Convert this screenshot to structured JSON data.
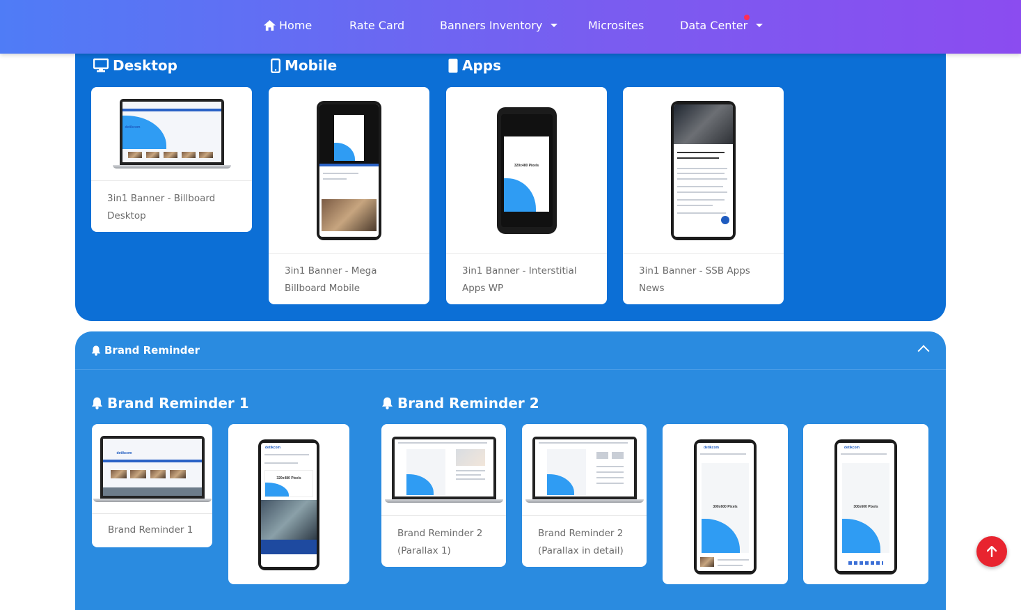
{
  "nav": {
    "home": "Home",
    "rate_card": "Rate Card",
    "banners_inventory": "Banners Inventory",
    "microsites": "Microsites",
    "data_center": "Data Center"
  },
  "sections": {
    "desktop": "Desktop",
    "mobile": "Mobile",
    "apps": "Apps"
  },
  "cards_top": [
    {
      "caption": "3in1 Banner - Billboard Desktop"
    },
    {
      "caption": "3in1 Banner - Mega Billboard Mobile"
    },
    {
      "caption": "3in1 Banner - Interstitial Apps WP"
    },
    {
      "caption": "3in1 Banner - SSB Apps News"
    }
  ],
  "brand_reminder": {
    "title": "Brand Reminder",
    "group1": "Brand Reminder 1",
    "group2": "Brand Reminder 2",
    "cards": [
      {
        "caption": "Brand Reminder 1"
      },
      {
        "caption": ""
      },
      {
        "caption": "Brand Reminder 2 (Parallax 1)"
      },
      {
        "caption": "Brand Reminder 2 (Parallax in detail)"
      },
      {
        "caption": ""
      },
      {
        "caption": ""
      }
    ]
  },
  "mock": {
    "pixels_label": "300x600 Pixels",
    "pixels_label_small": "320x480 Pixels",
    "brand": "detikcom"
  },
  "colors": {
    "nav_gradient_start": "#4f7cf6",
    "nav_gradient_end": "#8b4cf0",
    "panel_blue": "#0c6fd6",
    "panel_blue_light": "#2a8be0",
    "fab_red": "#e8242f",
    "notif_dot": "#ff2d55"
  },
  "icons": {
    "home": "home-icon",
    "desktop": "monitor-icon",
    "mobile": "phone-icon",
    "apps": "tablet-icon",
    "bell": "bell-icon",
    "collapse": "chevron-up-icon",
    "scroll_top": "arrow-up-icon"
  }
}
